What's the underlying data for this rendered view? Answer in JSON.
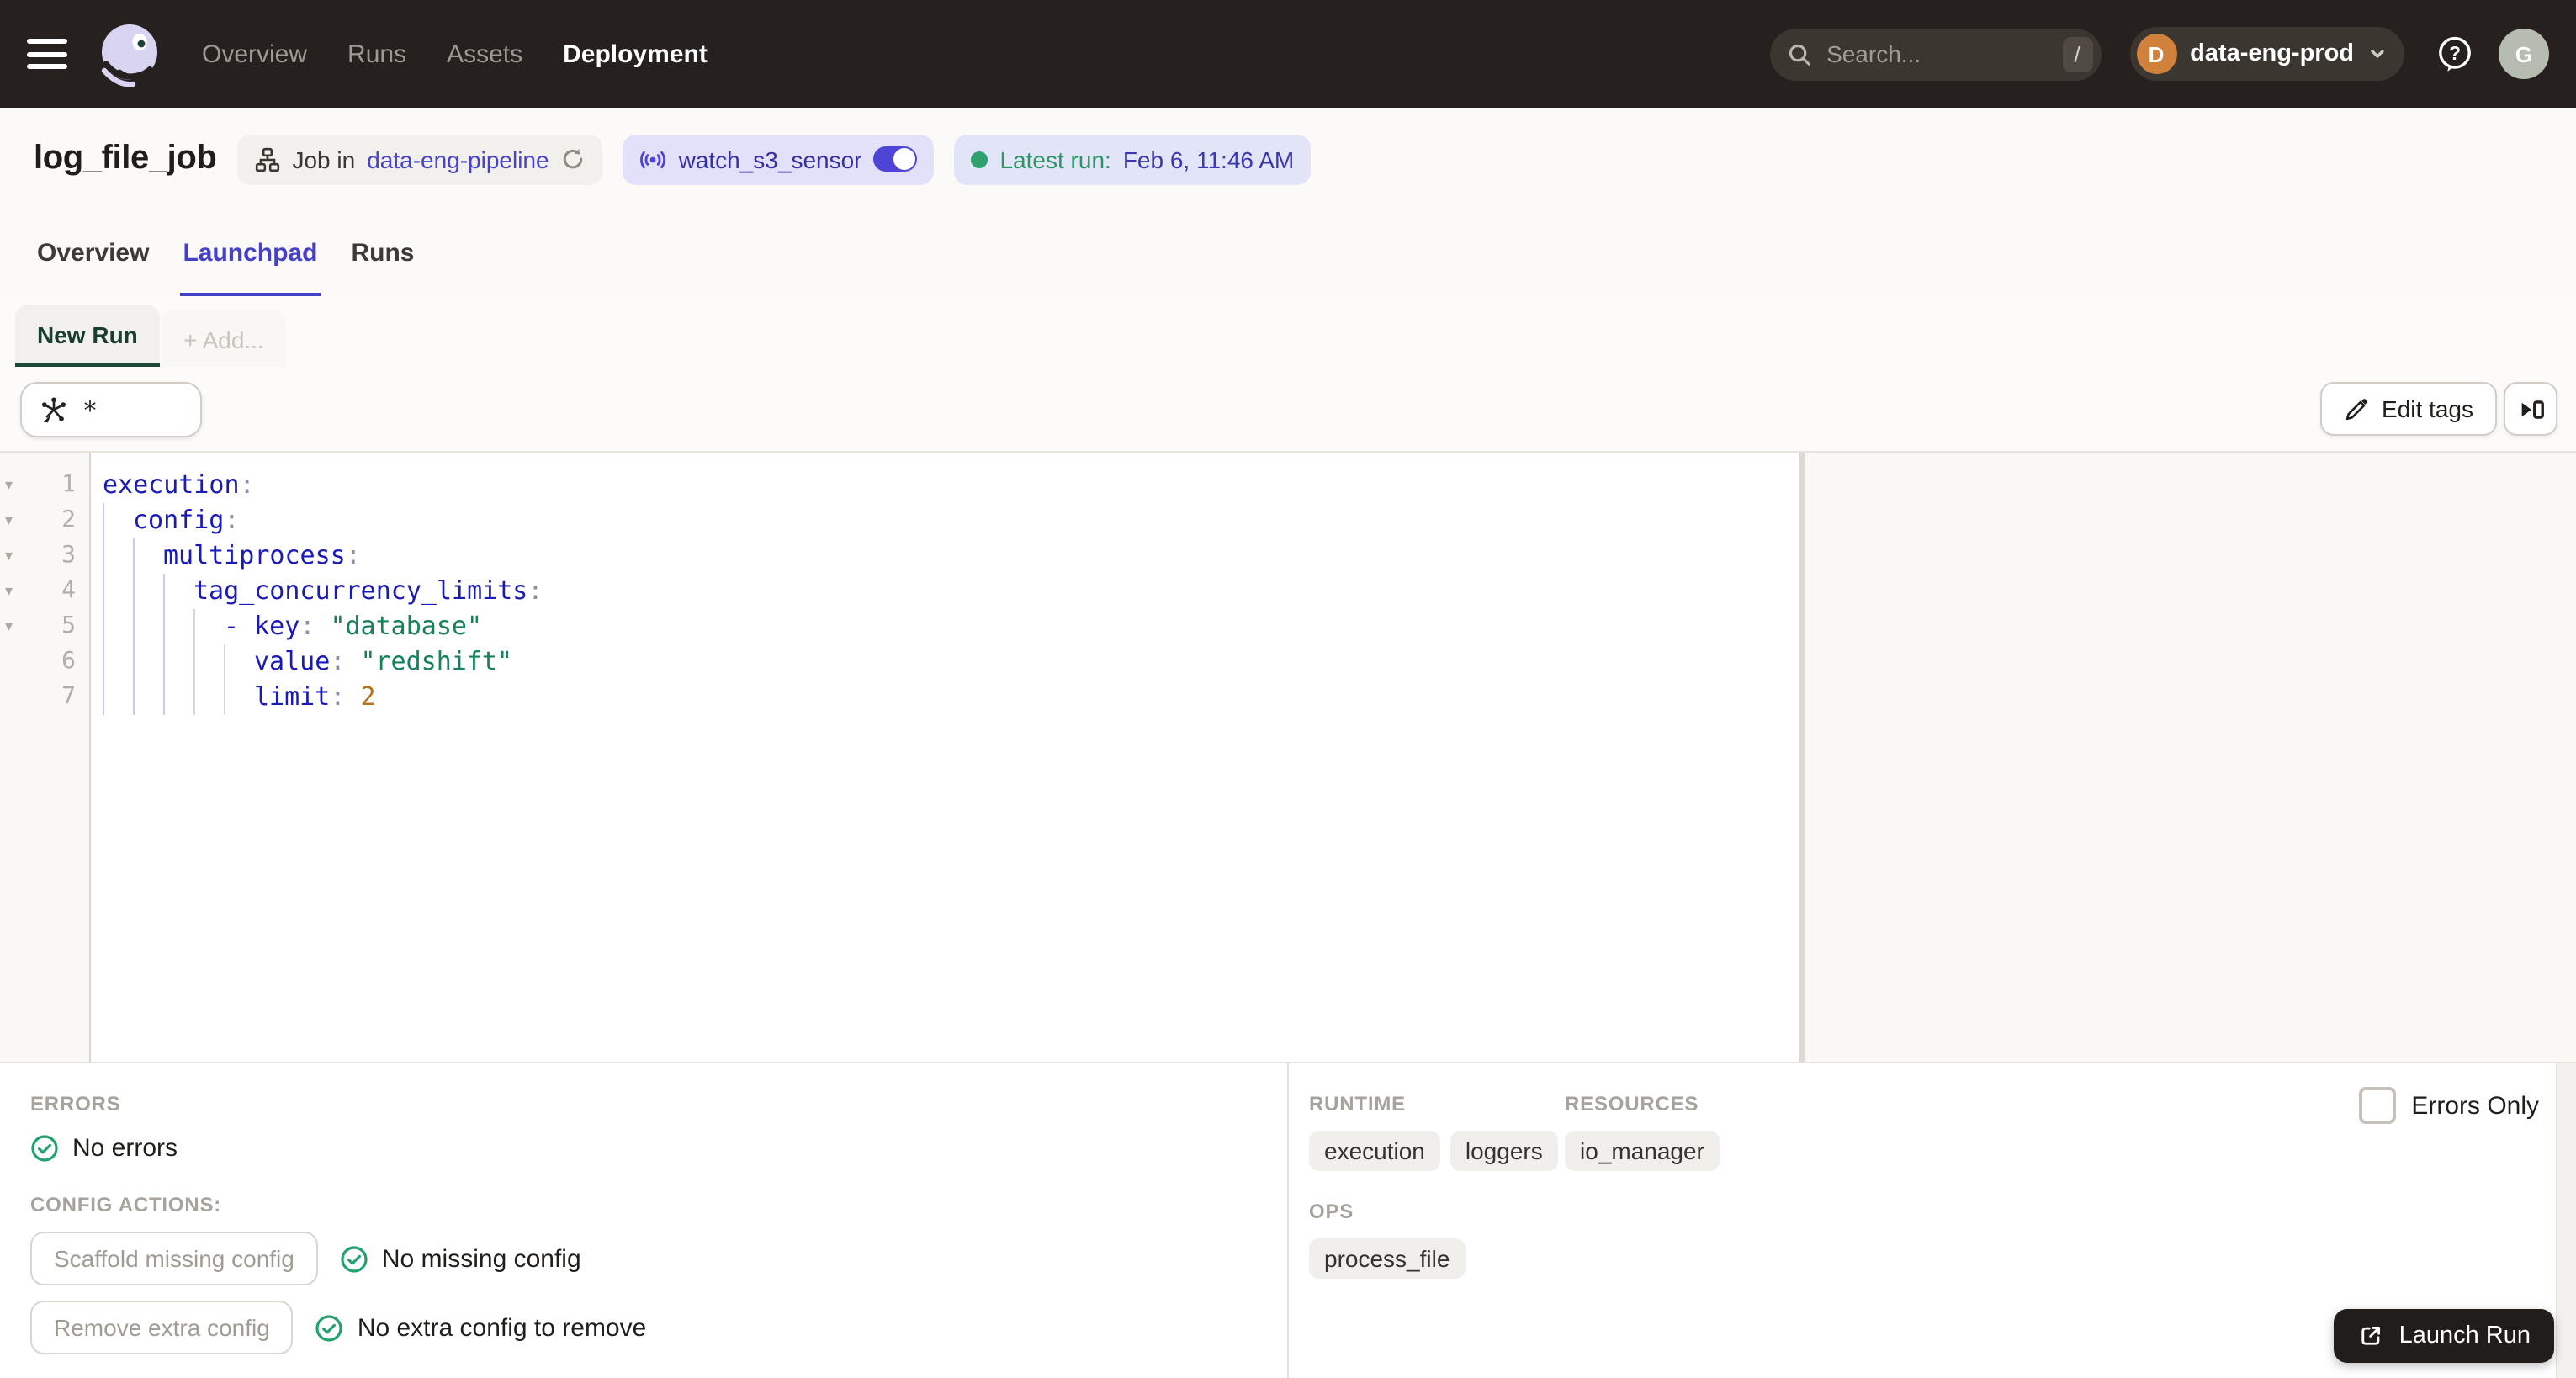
{
  "colors": {
    "accent": "#4540C8",
    "success_green": "#23A26D",
    "nav_bg": "#26211E",
    "code_key": "#1A1AB8",
    "code_string": "#15835A",
    "code_number": "#B5741C"
  },
  "nav": {
    "items": [
      "Overview",
      "Runs",
      "Assets",
      "Deployment"
    ],
    "active_item": "Deployment",
    "search": {
      "placeholder": "Search...",
      "shortcut": "/"
    },
    "deployment_switcher": {
      "initial": "D",
      "name": "data-eng-prod"
    },
    "user_initial": "G"
  },
  "header": {
    "title": "log_file_job",
    "job_pill": {
      "prefix": "Job in",
      "location": "data-eng-pipeline"
    },
    "sensor_pill": {
      "name": "watch_s3_sensor",
      "enabled": true
    },
    "latest_run_pill": {
      "label": "Latest run:",
      "time": "Feb 6, 11:46 AM"
    }
  },
  "tabs": {
    "items": [
      "Overview",
      "Launchpad",
      "Runs"
    ],
    "active": "Launchpad"
  },
  "session": {
    "active_tab": "New Run",
    "add_tab": "+ Add...",
    "op_selector_value": "*"
  },
  "toolbar": {
    "edit_tags": "Edit tags"
  },
  "editor": {
    "lines": [
      {
        "n": 1,
        "fold": true,
        "indent": 0,
        "tokens": [
          [
            "k",
            "execution"
          ],
          [
            "p",
            ":"
          ]
        ]
      },
      {
        "n": 2,
        "fold": true,
        "indent": 2,
        "tokens": [
          [
            "k",
            "config"
          ],
          [
            "p",
            ":"
          ]
        ]
      },
      {
        "n": 3,
        "fold": true,
        "indent": 4,
        "tokens": [
          [
            "k",
            "multiprocess"
          ],
          [
            "p",
            ":"
          ]
        ]
      },
      {
        "n": 4,
        "fold": true,
        "indent": 6,
        "tokens": [
          [
            "k",
            "tag_concurrency_limits"
          ],
          [
            "p",
            ":"
          ]
        ]
      },
      {
        "n": 5,
        "fold": true,
        "indent": 8,
        "tokens": [
          [
            "d",
            "- "
          ],
          [
            "k",
            "key"
          ],
          [
            "p",
            ":"
          ],
          [
            "w",
            " "
          ],
          [
            "s",
            "\"database\""
          ]
        ]
      },
      {
        "n": 6,
        "fold": false,
        "indent": 10,
        "tokens": [
          [
            "k",
            "value"
          ],
          [
            "p",
            ":"
          ],
          [
            "w",
            " "
          ],
          [
            "s",
            "\"redshift\""
          ]
        ]
      },
      {
        "n": 7,
        "fold": false,
        "indent": 10,
        "tokens": [
          [
            "k",
            "limit"
          ],
          [
            "p",
            ":"
          ],
          [
            "w",
            " "
          ],
          [
            "num",
            "2"
          ]
        ]
      }
    ]
  },
  "errors_panel": {
    "errors_label": "ERRORS",
    "no_errors": "No errors",
    "actions_label": "CONFIG ACTIONS:",
    "scaffold_button": "Scaffold missing config",
    "scaffold_status": "No missing config",
    "remove_button": "Remove extra config",
    "remove_status": "No extra config to remove"
  },
  "structure_panel": {
    "errors_only_label": "Errors Only",
    "runtime_label": "RUNTIME",
    "runtime_tags": [
      "execution",
      "loggers"
    ],
    "resources_label": "RESOURCES",
    "resources_tags": [
      "io_manager"
    ],
    "ops_label": "OPS",
    "ops_tags": [
      "process_file"
    ],
    "launch_button": "Launch Run"
  }
}
